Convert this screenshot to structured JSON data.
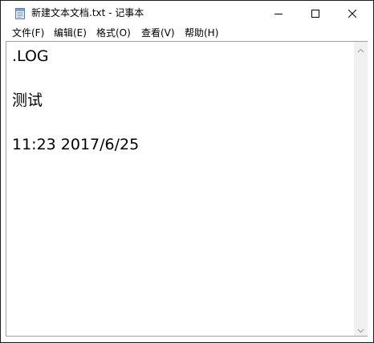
{
  "window": {
    "title": "新建文本文档.txt - 记事本",
    "icon": "notepad-icon",
    "controls": [
      "minimize-icon",
      "maximize-icon",
      "close-icon"
    ]
  },
  "menubar": {
    "items": [
      {
        "label": "文件(F)"
      },
      {
        "label": "编辑(E)"
      },
      {
        "label": "格式(O)"
      },
      {
        "label": "查看(V)"
      },
      {
        "label": "帮助(H)"
      }
    ]
  },
  "editor": {
    "lines": [
      ".LOG",
      "测试",
      "11:23 2017/6/25"
    ]
  },
  "colors": {
    "window_bg": "#ffffff",
    "border": "#a0a0a0",
    "scrollbar": "#f0f0f0",
    "desktop": "#4a4a4a"
  }
}
